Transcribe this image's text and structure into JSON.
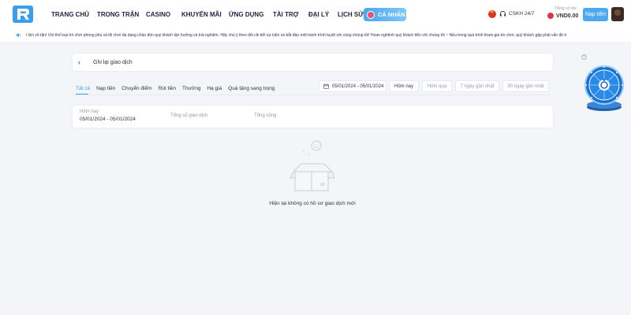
{
  "header": {
    "nav": [
      "TRANG CHỦ",
      "TRONG TRẬN",
      "CASINO",
      "KHUYẾN MÃI",
      "ỨNG DỤNG",
      "TÀI TRỢ",
      "ĐẠI LÝ",
      "LỊCH SỬ"
    ],
    "active_nav": "CÁ NHÂN",
    "support": "CSKH 24/7",
    "balance_label": "Tổng số dư",
    "balance": "VND0.00",
    "deposit_label": "Nạp tiền"
  },
  "marquee": {
    "text": "i lịch vô tận! Với thế loại trò chơi phong phú và lối chơi đa dạng chào đón quý khách tận hưởng và trải nghiệm. Hãy chú ý theo dõi chi tiết sự kiện và bắt đầu một hành trình tuyệt vời cùng chúng tôi! Hoan nghênh quý khách đến với chúng tôi ~ Nếu trong quá trình tham gia trò chơi, quý khách gặp phải vấn đề tr"
  },
  "page": {
    "title": "Ghi lại giao dịch",
    "tabs": [
      "Tất cả",
      "Nạp tiền",
      "Chuyển điểm",
      "Rút tiền",
      "Thưởng",
      "Hạ giá",
      "Quà tặng sang trọng"
    ],
    "date_range": "05/01/2024 - 05/01/2024",
    "quick_filters": [
      "Hôm nay",
      "Hôm qua",
      "7 ngày gần nhất",
      "30 ngày gần nhất"
    ],
    "summary": {
      "period_label": "Hôm nay",
      "period_value": "05/01/2024 - 05/01/2024",
      "total_tx_label": "Tổng số giao dịch",
      "total_label": "Tổng cộng"
    },
    "empty_text": "Hiện tại không có hồ sơ giao dịch mới"
  },
  "colors": {
    "accent": "#3c9ee8",
    "nav_text": "#1d2440",
    "background": "#f3f5f9"
  },
  "icons": {
    "logo": "brand-logo",
    "flag": "vietnam-flag-icon",
    "support": "headset-icon",
    "marquee": "speaker-icon",
    "back": "chevron-left-icon",
    "calendar": "calendar-icon",
    "empty": "empty-box-icon",
    "wheel": "lucky-wheel-icon"
  }
}
